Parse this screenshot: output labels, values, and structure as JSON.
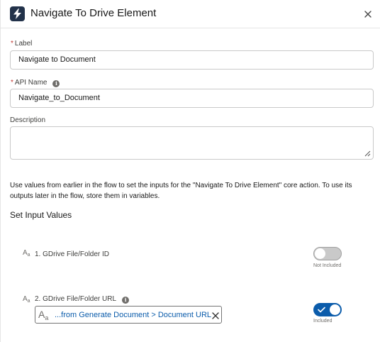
{
  "header": {
    "title": "Navigate To Drive Element",
    "icon": "lightning-bolt-icon",
    "close_icon": "close-icon"
  },
  "form": {
    "label": {
      "caption": "Label",
      "required_mark": "*",
      "value": "Navigate to Document"
    },
    "api_name": {
      "caption": "API Name",
      "required_mark": "*",
      "value": "Navigate_to_Document",
      "info_glyph": "i"
    },
    "description": {
      "caption": "Description",
      "value": ""
    }
  },
  "help_text": "Use values from earlier in the flow to set the inputs for the \"Navigate To Drive Element\" core action. To use its outputs later in the flow, store them in variables.",
  "section_title": "Set Input Values",
  "inputs": [
    {
      "type_glyph": "A",
      "type_sub": "a",
      "label": "1. GDrive File/Folder ID",
      "included": false,
      "toggle_label": "Not Included"
    },
    {
      "type_glyph": "A",
      "type_sub": "a",
      "label": "2. GDrive File/Folder URL",
      "info_glyph": "i",
      "included": true,
      "toggle_label": "Included",
      "pill": {
        "type_glyph": "A",
        "type_sub": "a",
        "text": "...from Generate Document > Document URL"
      }
    }
  ],
  "colors": {
    "brand": "#0b5cab",
    "header_icon_bg": "#22324a",
    "required": "#c23934",
    "toggle_off": "#c9c9c9"
  }
}
